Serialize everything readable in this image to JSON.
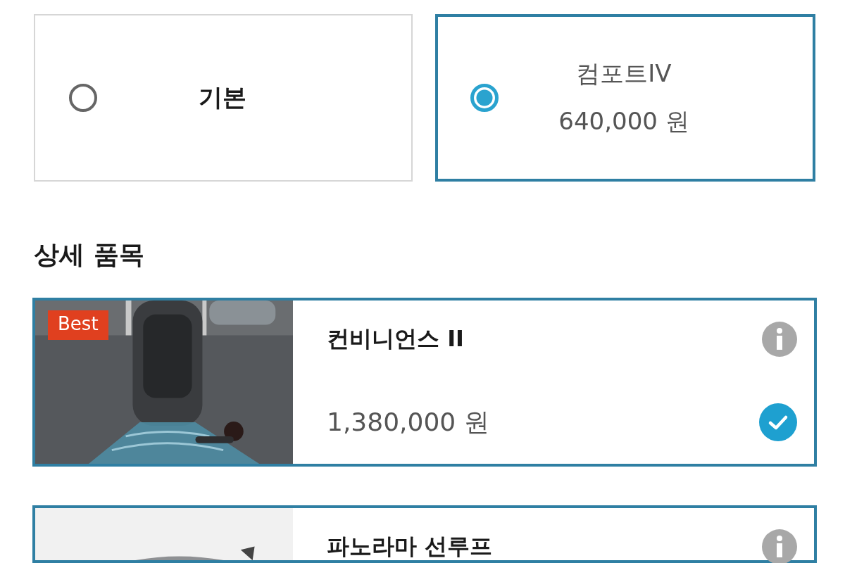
{
  "trims": [
    {
      "name": "기본",
      "selected": false
    },
    {
      "name": "컴포트IV",
      "price": "640,000 원",
      "selected": true
    }
  ],
  "details_heading": "상세 품목",
  "items": [
    {
      "badge": "Best",
      "title": "컨비니언스 II",
      "price": "1,380,000 원",
      "checked": true
    },
    {
      "title": "파노라마 선루프"
    }
  ]
}
